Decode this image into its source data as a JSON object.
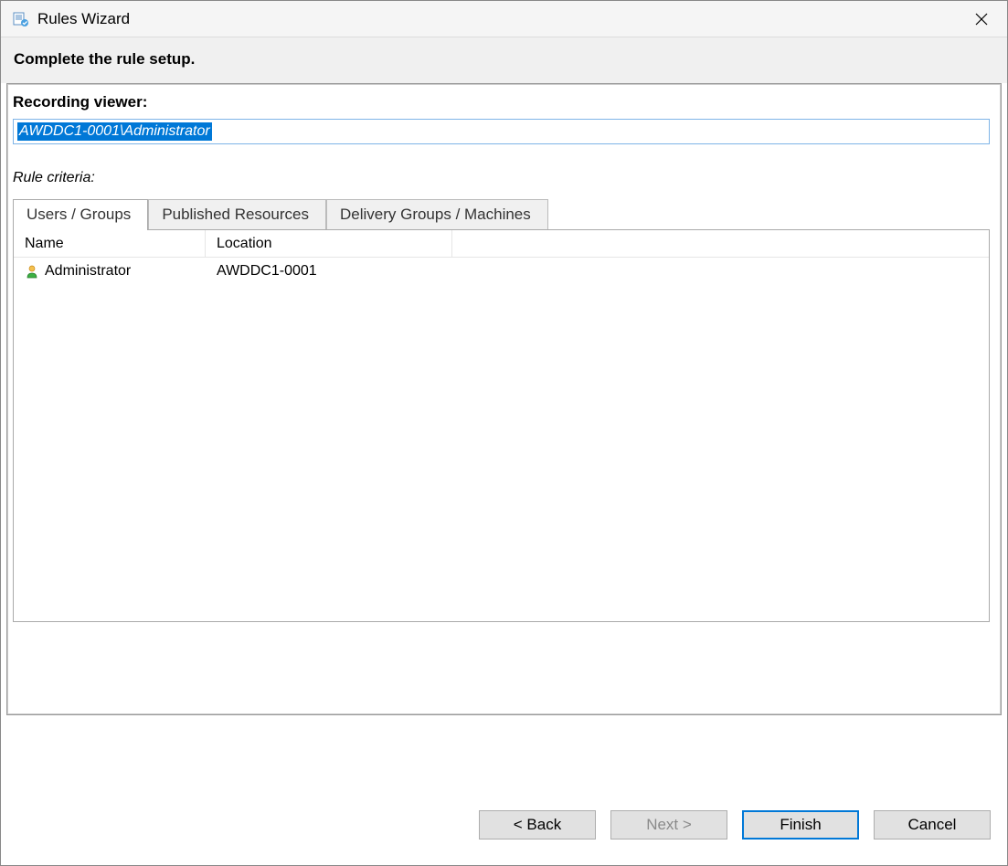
{
  "titlebar": {
    "title": "Rules Wizard"
  },
  "header": {
    "text": "Complete the rule setup."
  },
  "recording_viewer": {
    "label": "Recording viewer:",
    "value": "AWDDC1-0001\\Administrator"
  },
  "criteria": {
    "label": "Rule criteria:",
    "tabs": [
      {
        "label": "Users / Groups",
        "active": true
      },
      {
        "label": "Published Resources",
        "active": false
      },
      {
        "label": "Delivery Groups / Machines",
        "active": false
      }
    ],
    "columns": {
      "name": "Name",
      "location": "Location"
    },
    "rows": [
      {
        "name": "Administrator",
        "location": "AWDDC1-0001"
      }
    ]
  },
  "buttons": {
    "back": "< Back",
    "next": "Next >",
    "finish": "Finish",
    "cancel": "Cancel"
  }
}
